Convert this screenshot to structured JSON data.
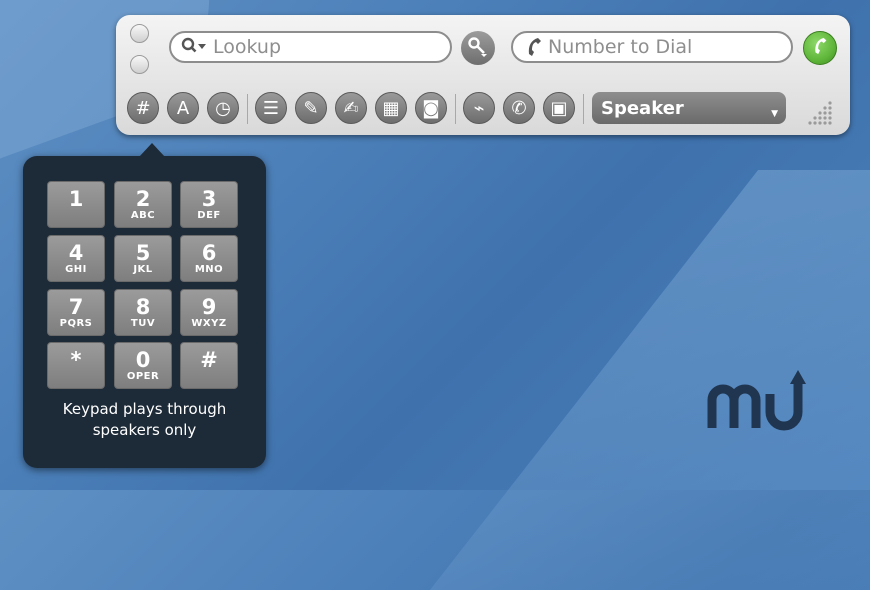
{
  "search": {
    "lookup_placeholder": "Lookup",
    "dial_placeholder": "Number to Dial"
  },
  "toolbar": {
    "icons": [
      {
        "name": "keypad-icon",
        "glyph": "#"
      },
      {
        "name": "contacts-icon",
        "glyph": "A"
      },
      {
        "name": "history-clock-icon",
        "glyph": "◷"
      },
      {
        "name": "list-icon",
        "glyph": "☰"
      },
      {
        "name": "pencil-icon",
        "glyph": "✎"
      },
      {
        "name": "notes-icon",
        "glyph": "✍"
      },
      {
        "name": "table-icon",
        "glyph": "▦"
      },
      {
        "name": "record-icon",
        "glyph": "◙"
      },
      {
        "name": "signal-icon",
        "glyph": "⌁"
      },
      {
        "name": "call-options-icon",
        "glyph": "✆"
      },
      {
        "name": "screen-icon",
        "glyph": "▣"
      }
    ],
    "audio_output": "Speaker"
  },
  "keypad": {
    "keys": [
      {
        "digit": "1",
        "letters": ""
      },
      {
        "digit": "2",
        "letters": "ABC"
      },
      {
        "digit": "3",
        "letters": "DEF"
      },
      {
        "digit": "4",
        "letters": "GHI"
      },
      {
        "digit": "5",
        "letters": "JKL"
      },
      {
        "digit": "6",
        "letters": "MNO"
      },
      {
        "digit": "7",
        "letters": "PQRS"
      },
      {
        "digit": "8",
        "letters": "TUV"
      },
      {
        "digit": "9",
        "letters": "WXYZ"
      },
      {
        "digit": "*",
        "letters": ""
      },
      {
        "digit": "0",
        "letters": "OPER"
      },
      {
        "digit": "#",
        "letters": ""
      }
    ],
    "note_line1": "Keypad plays through",
    "note_line2": "speakers only"
  },
  "colors": {
    "call_green": "#5fb63a",
    "popover_bg": "#1d2a38",
    "logo_navy": "#1f3550"
  }
}
